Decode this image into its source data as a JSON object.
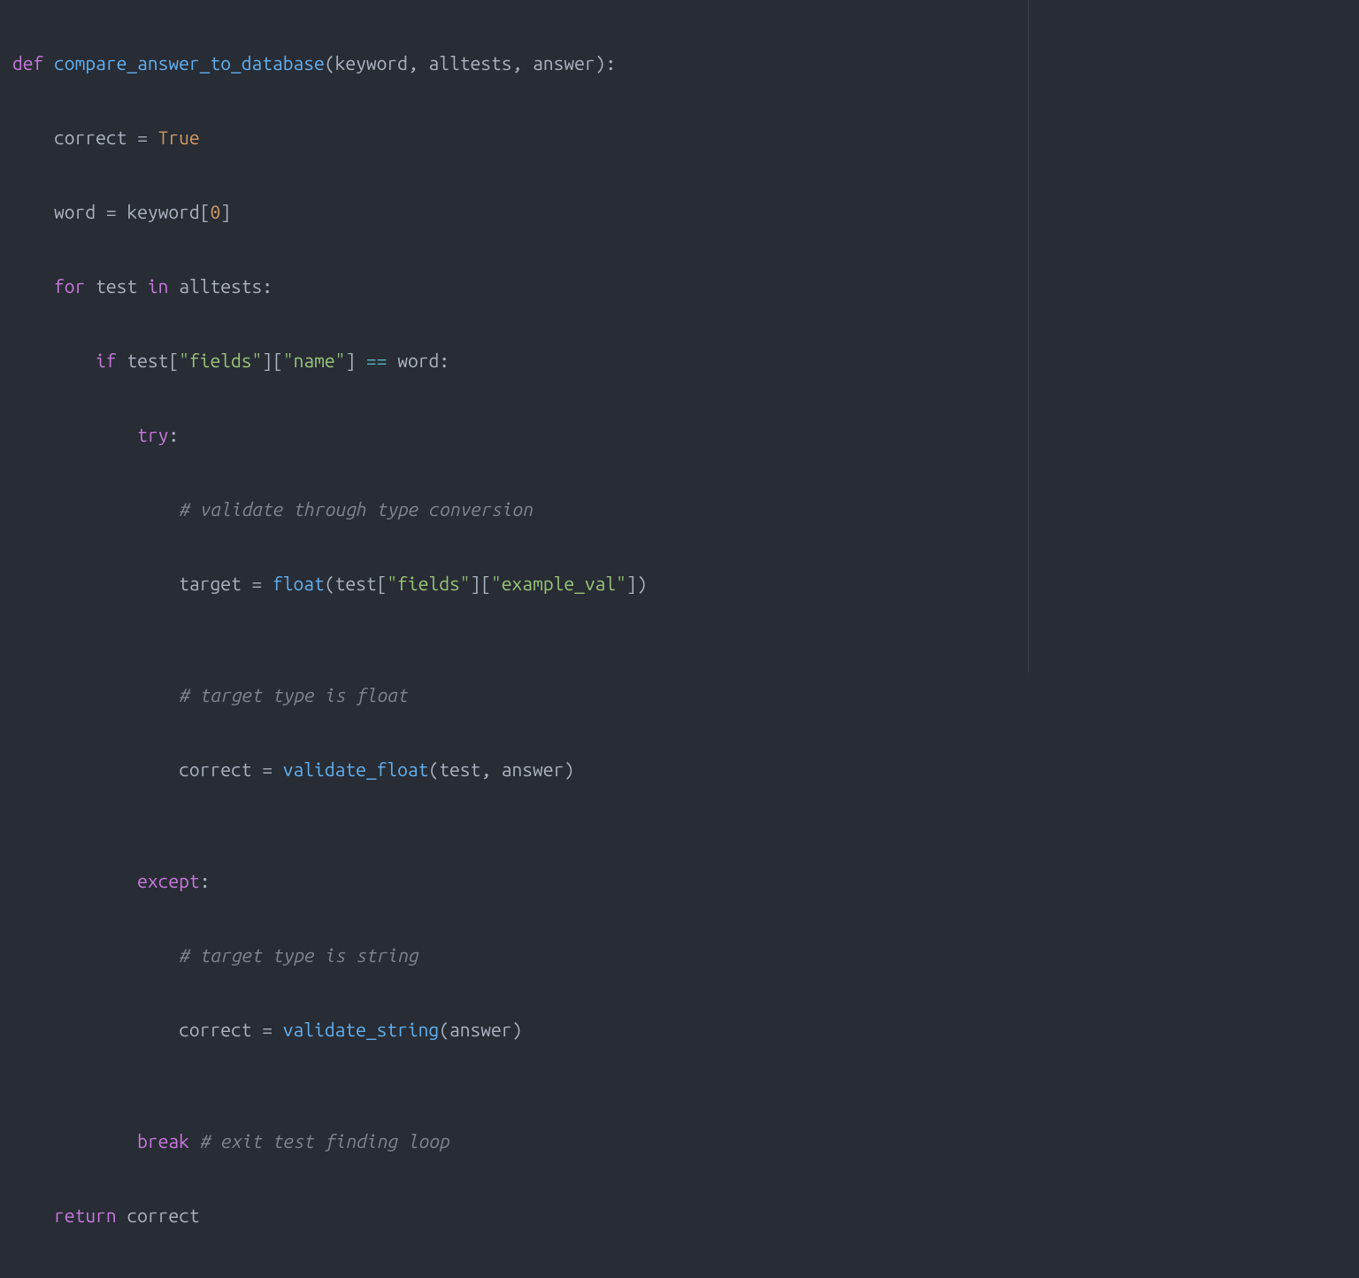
{
  "code": {
    "l1": {
      "def": "def",
      "fname": "compare_answer_to_database",
      "lp": "(",
      "p1": "keyword",
      "c1": ", ",
      "p2": "alltests",
      "c2": ", ",
      "p3": "answer",
      "rp": ")",
      "colon": ":"
    },
    "l2": {
      "indent": "    ",
      "var": "correct",
      "eq": " = ",
      "val": "True"
    },
    "l3": {
      "indent": "    ",
      "var": "word",
      "eq": " = ",
      "src": "keyword",
      "lb": "[",
      "idx": "0",
      "rb": "]"
    },
    "l4": {
      "indent": "    ",
      "for": "for",
      "sp1": " ",
      "var": "test",
      "sp2": " ",
      "in": "in",
      "sp3": " ",
      "iter": "alltests",
      "colon": ":"
    },
    "l5": {
      "indent": "        ",
      "if": "if",
      "sp1": " ",
      "obj": "test",
      "lb1": "[",
      "k1": "\"fields\"",
      "rb1": "]",
      "lb2": "[",
      "k2": "\"name\"",
      "rb2": "]",
      "sp2": " ",
      "eqeq": "==",
      "sp3": " ",
      "rhs": "word",
      "colon": ":"
    },
    "l6": {
      "indent": "            ",
      "try": "try",
      "colon": ":"
    },
    "l7": {
      "indent": "                ",
      "comment": "# validate through type conversion"
    },
    "l8": {
      "indent": "                ",
      "var": "target",
      "eq": " = ",
      "fn": "float",
      "lp": "(",
      "obj": "test",
      "lb1": "[",
      "k1": "\"fields\"",
      "rb1": "]",
      "lb2": "[",
      "k2": "\"example_val\"",
      "rb2": "]",
      "rp": ")"
    },
    "l9": {
      "indent": ""
    },
    "l10": {
      "indent": "                ",
      "comment": "# target type is float"
    },
    "l11": {
      "indent": "                ",
      "var": "correct",
      "eq": " = ",
      "fn": "validate_float",
      "lp": "(",
      "a1": "test",
      "c": ", ",
      "a2": "answer",
      "rp": ")"
    },
    "l12": {
      "indent": ""
    },
    "l13": {
      "indent": "            ",
      "except": "except",
      "colon": ":"
    },
    "l14": {
      "indent": "                ",
      "comment": "# target type is string"
    },
    "l15": {
      "indent": "                ",
      "var": "correct",
      "eq": " = ",
      "fn": "validate_string",
      "lp": "(",
      "a1": "answer",
      "rp": ")"
    },
    "l16": {
      "indent": ""
    },
    "l17": {
      "indent": "            ",
      "break": "break",
      "sp": " ",
      "comment": "# exit test finding loop"
    },
    "l18": {
      "indent": "    ",
      "return": "return",
      "sp": " ",
      "val": "correct"
    }
  }
}
